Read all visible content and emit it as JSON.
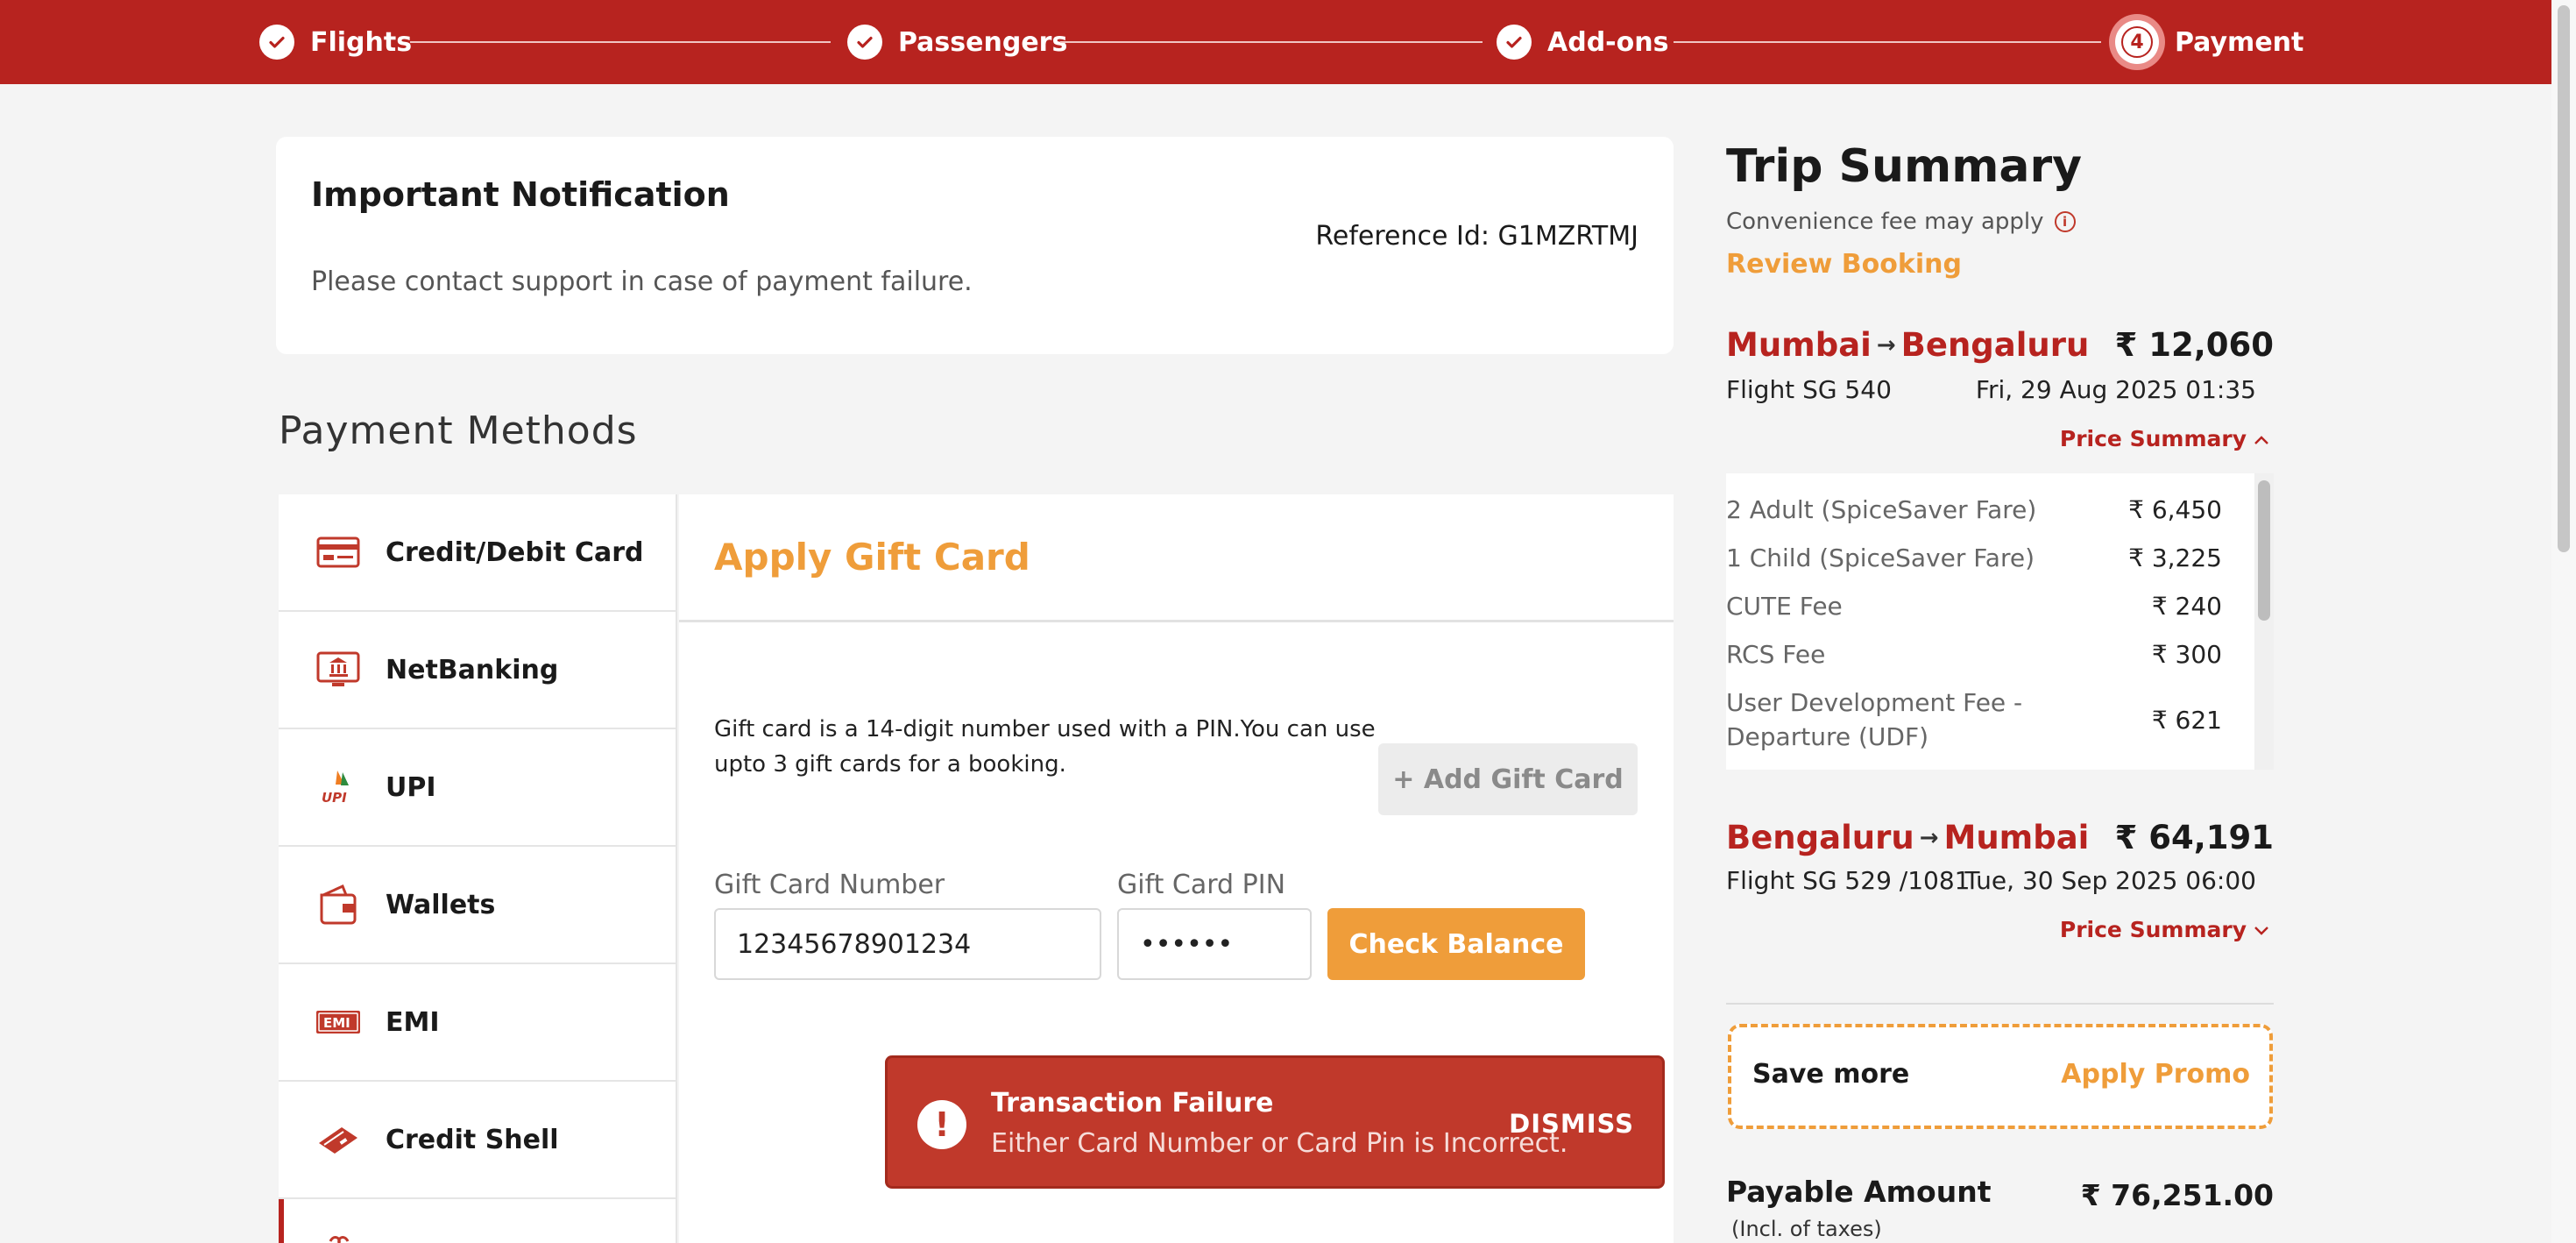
{
  "stepper": {
    "steps": [
      {
        "label": "Flights",
        "state": "done"
      },
      {
        "label": "Passengers",
        "state": "done"
      },
      {
        "label": "Add-ons",
        "state": "done"
      },
      {
        "label": "Payment",
        "number": "4",
        "state": "current"
      }
    ]
  },
  "notification": {
    "title": "Important Notification",
    "reference": "Reference Id: G1MZRTMJ",
    "message": "Please contact support in case of payment failure."
  },
  "payment_methods": {
    "heading": "Payment Methods",
    "items": [
      {
        "label": "Credit/Debit Card",
        "icon": "credit-card-icon"
      },
      {
        "label": "NetBanking",
        "icon": "netbanking-icon"
      },
      {
        "label": "UPI",
        "icon": "upi-icon"
      },
      {
        "label": "Wallets",
        "icon": "wallet-icon"
      },
      {
        "label": "EMI",
        "icon": "emi-icon"
      },
      {
        "label": "Credit Shell",
        "icon": "credit-shell-icon"
      },
      {
        "label": "",
        "icon": "gift-card-icon"
      }
    ]
  },
  "gift_card": {
    "title": "Apply Gift Card",
    "description": "Gift card is a 14-digit number used with a PIN.You can use upto 3 gift cards for a booking.",
    "add_label": "+ Add Gift Card",
    "number_label": "Gift Card Number",
    "number_value": "12345678901234",
    "pin_label": "Gift Card PIN",
    "pin_value": "••••••",
    "check_label": "Check Balance"
  },
  "toast": {
    "title": "Transaction Failure",
    "message": "Either Card Number or Card Pin is Incorrect.",
    "dismiss": "DISMISS"
  },
  "trip_summary": {
    "title": "Trip Summary",
    "convenience_note": "Convenience fee may apply",
    "review_label": "Review Booking",
    "outbound": {
      "from": "Mumbai",
      "to": "Bengaluru",
      "fare": "₹ 12,060",
      "flight": "Flight  SG 540",
      "datetime": "Fri, 29 Aug 2025  01:35",
      "price_summary_label": "Price Summary",
      "breakdown": [
        {
          "label": "2 Adult  (SpiceSaver Fare)",
          "amount": "₹ 6,450"
        },
        {
          "label": "1 Child  (SpiceSaver Fare)",
          "amount": "₹ 3,225"
        },
        {
          "label": "CUTE Fee",
          "amount": "₹ 240"
        },
        {
          "label": "RCS Fee",
          "amount": "₹ 300"
        },
        {
          "label": "User Development Fee - Departure (UDF)",
          "amount": "₹ 621"
        }
      ]
    },
    "return": {
      "from": "Bengaluru",
      "to": "Mumbai",
      "fare": "₹ 64,191",
      "flight": "Flight  SG 529 /1081",
      "datetime": "Tue, 30 Sep 2025  06:00",
      "price_summary_label": "Price Summary"
    },
    "promo": {
      "save_label": "Save more",
      "apply_label": "Apply Promo"
    },
    "payable_label": "Payable Amount",
    "payable_amount": "₹ 76,251.00",
    "incl_taxes": "(Incl. of taxes)"
  },
  "colors": {
    "brand_red": "#b7231f",
    "accent_orange": "#ef9d3a",
    "error_red": "#c0392b"
  }
}
